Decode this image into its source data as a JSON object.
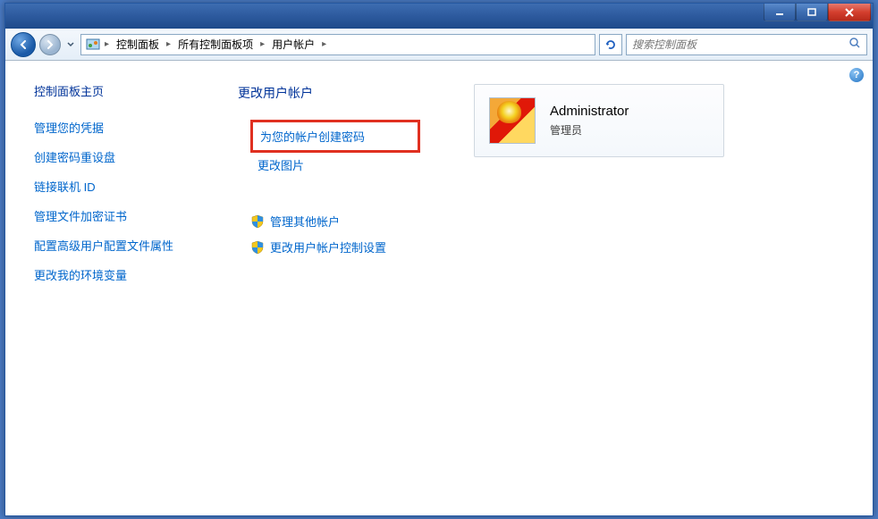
{
  "breadcrumb": {
    "items": [
      "控制面板",
      "所有控制面板项",
      "用户帐户"
    ]
  },
  "search": {
    "placeholder": "搜索控制面板"
  },
  "sidebar": {
    "title": "控制面板主页",
    "links": [
      "管理您的凭据",
      "创建密码重设盘",
      "链接联机 ID",
      "管理文件加密证书",
      "配置高级用户配置文件属性",
      "更改我的环境变量"
    ]
  },
  "main": {
    "title": "更改用户帐户",
    "actions": {
      "createPassword": "为您的帐户创建密码",
      "changePicture": "更改图片"
    },
    "shieldActions": [
      "管理其他帐户",
      "更改用户帐户控制设置"
    ]
  },
  "account": {
    "name": "Administrator",
    "role": "管理员"
  },
  "help": "?"
}
